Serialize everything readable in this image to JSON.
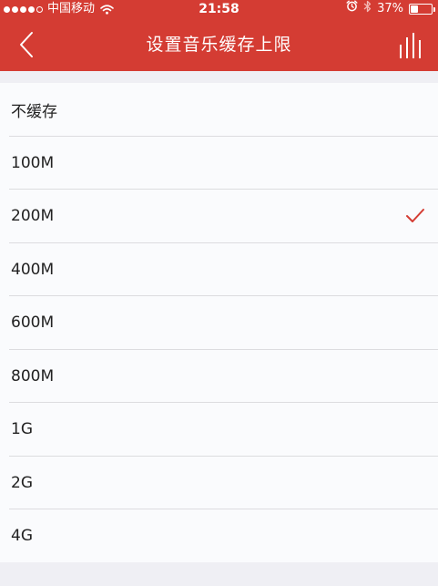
{
  "status_bar": {
    "carrier": "中国移动",
    "time": "21:58",
    "battery_percent": "37%",
    "battery_level": 0.37,
    "signal_bars_filled": 4,
    "signal_bars_total": 5
  },
  "header": {
    "title": "设置音乐缓存上限",
    "back_icon": "chevron-left-icon",
    "right_icon": "now-playing-bars-icon",
    "background_color": "#d43c33"
  },
  "options": {
    "items": [
      {
        "label": "不缓存",
        "selected": false
      },
      {
        "label": "100M",
        "selected": false
      },
      {
        "label": "200M",
        "selected": true
      },
      {
        "label": "400M",
        "selected": false
      },
      {
        "label": "600M",
        "selected": false
      },
      {
        "label": "800M",
        "selected": false
      },
      {
        "label": "1G",
        "selected": false
      },
      {
        "label": "2G",
        "selected": false
      },
      {
        "label": "4G",
        "selected": false
      }
    ],
    "selected_icon": "checkmark-icon",
    "accent_color": "#d43c33"
  }
}
